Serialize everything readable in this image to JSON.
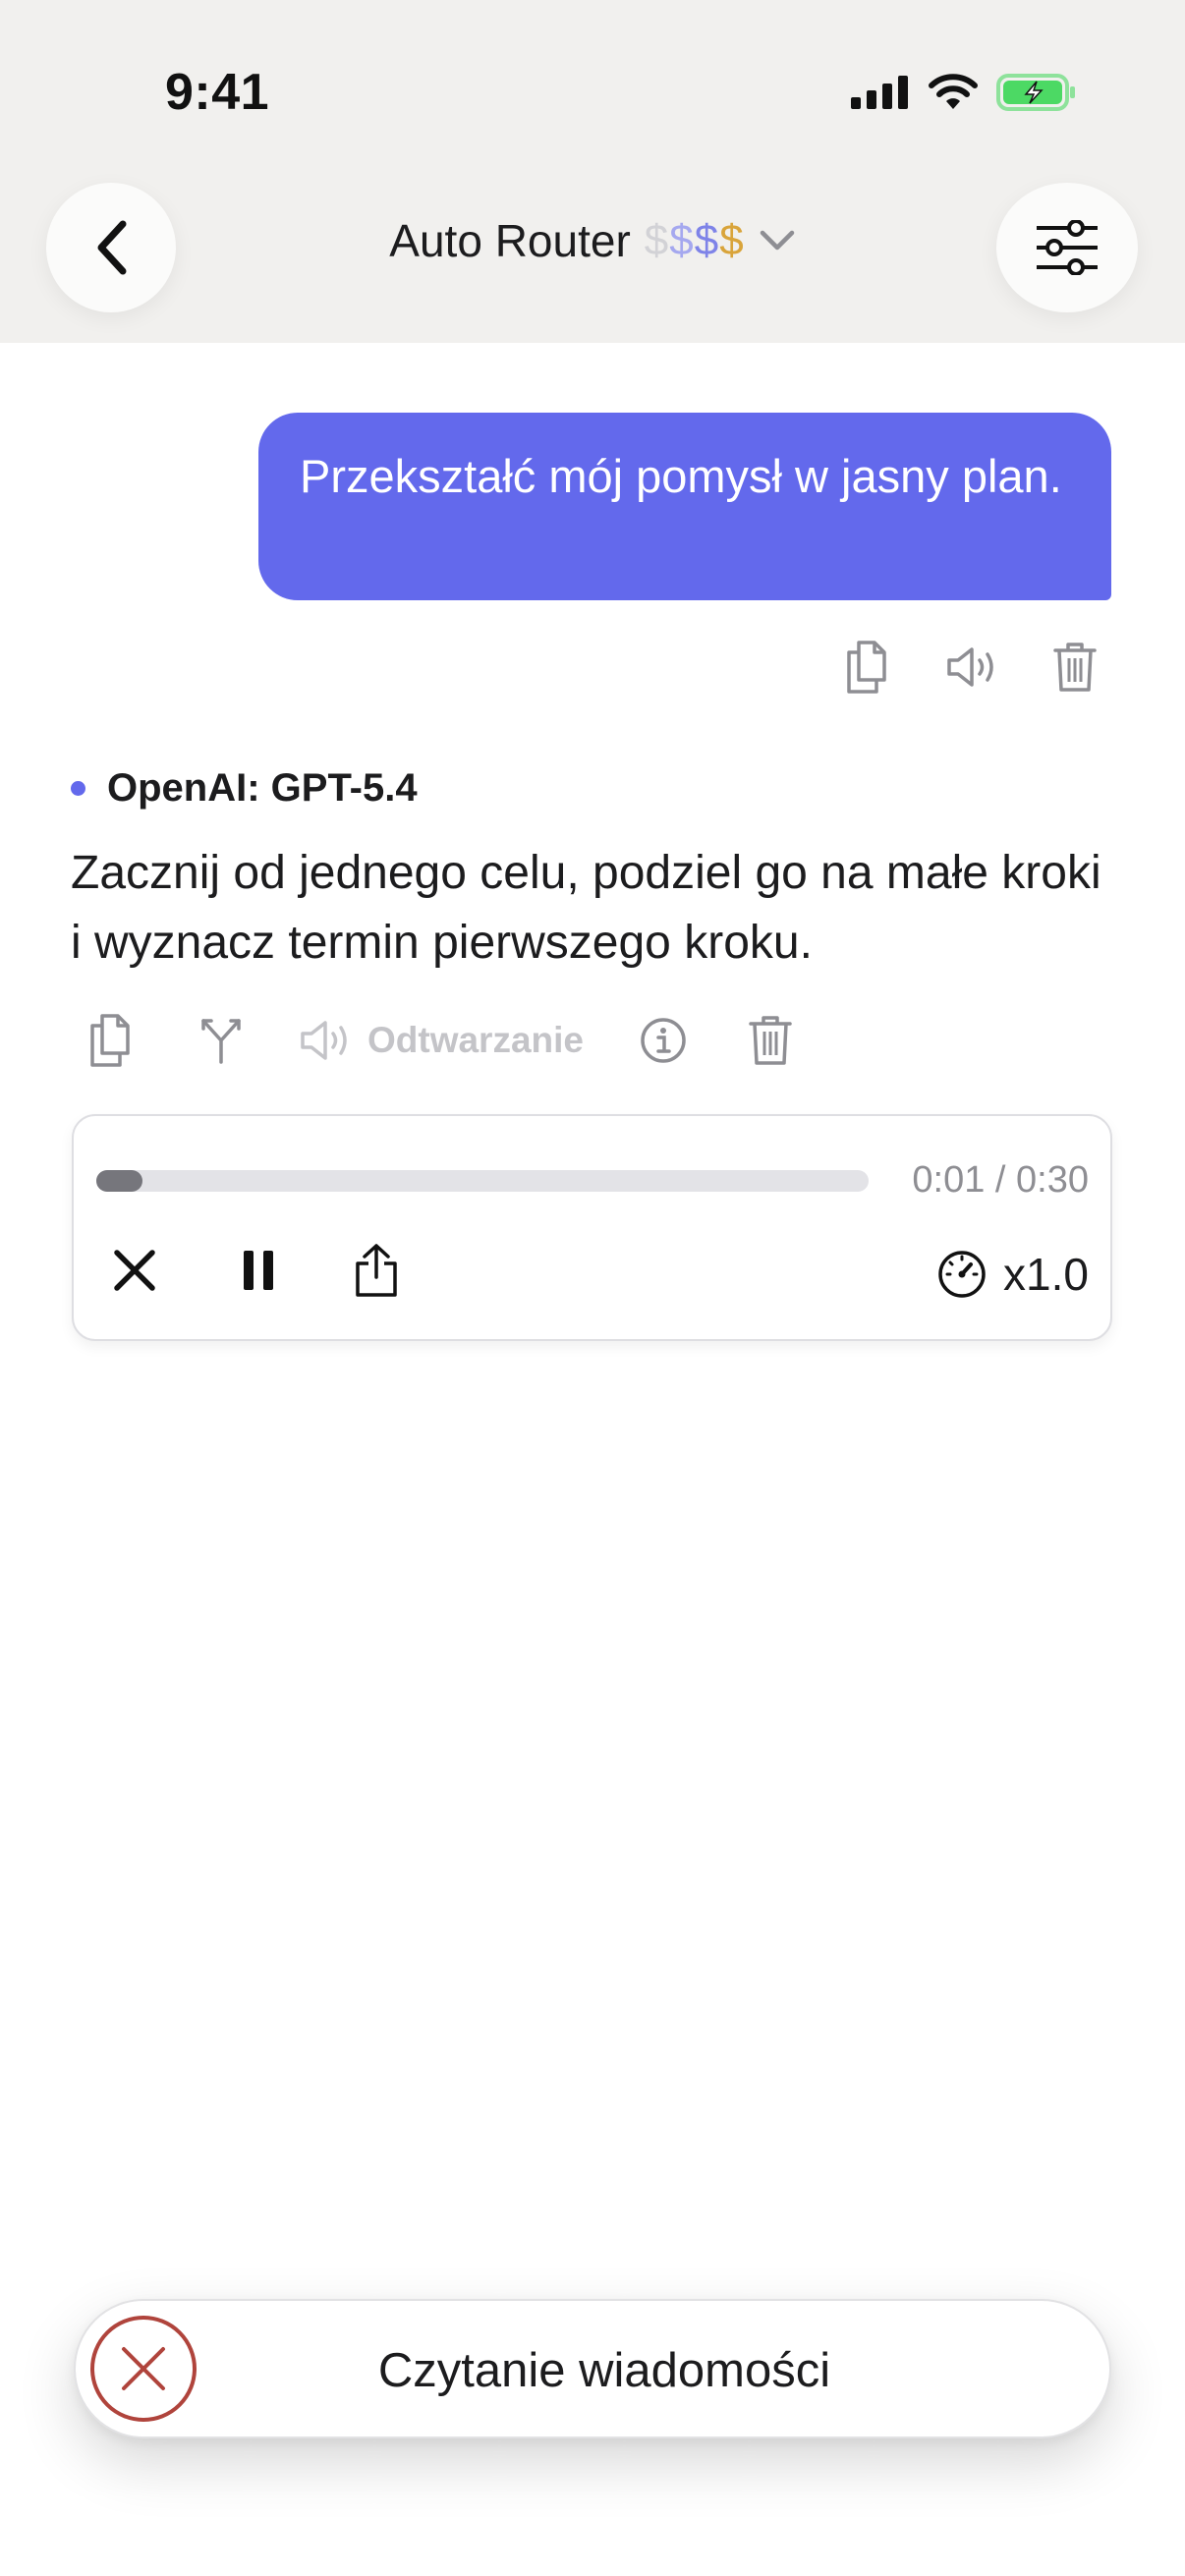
{
  "status_bar": {
    "time": "9:41"
  },
  "header": {
    "title": "Auto Router",
    "price_tier": [
      "$",
      "$",
      "$",
      "$"
    ]
  },
  "conversation": {
    "user_message": "Przekształć mój pomysł w jasny plan.",
    "model_label": "OpenAI: GPT-5.4",
    "assistant_message": "Zacznij od jednego celu, podziel go na małe kroki i wyznacz termin pierwszego kroku.",
    "playback_label": "Odtwarzanie"
  },
  "player": {
    "elapsed": "0:01",
    "duration": "0:30",
    "time_text": "0:01 / 0:30",
    "progress_fraction": 0.033,
    "speed": "x1.0"
  },
  "toast": {
    "text": "Czytanie wiadomości"
  },
  "colors": {
    "accent": "#6369ec",
    "header_bg": "#f1f0ee",
    "toast_close": "#b0443c",
    "battery": "#4cd964"
  }
}
